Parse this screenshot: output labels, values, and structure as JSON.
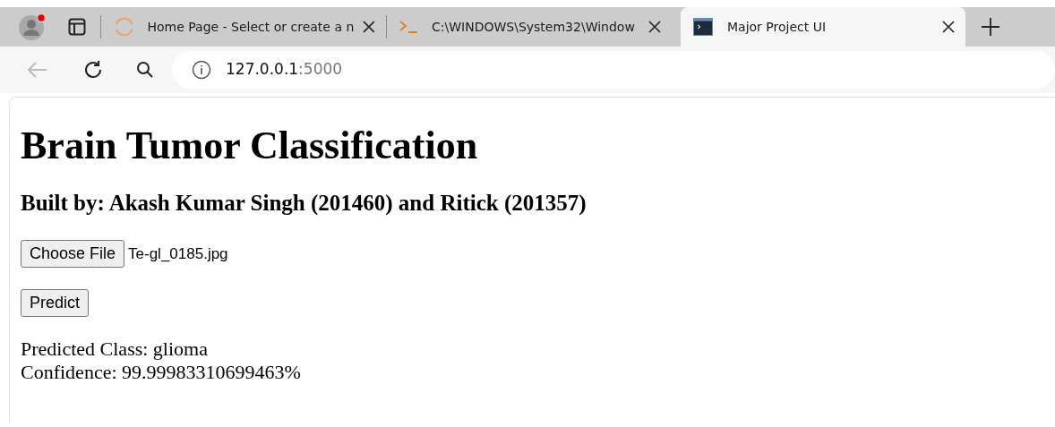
{
  "tabs": [
    {
      "title": "Home Page - Select or create a n",
      "kind": "loading",
      "selected": false
    },
    {
      "title": "C:\\WINDOWS\\System32\\Window",
      "kind": "console",
      "selected": false
    },
    {
      "title": "Major Project UI",
      "kind": "app",
      "selected": true
    }
  ],
  "address": {
    "host": "127.0.0.1",
    "port": ":5000"
  },
  "page": {
    "title": "Brain Tumor Classification",
    "subtitle": "Built by: Akash Kumar Singh (201460) and Ritick (201357)",
    "file_button": "Choose File",
    "file_name": "Te-gl_0185.jpg",
    "predict_button": "Predict",
    "results": [
      "Predicted Class: glioma",
      "Confidence: 99.99983310699463%"
    ]
  }
}
